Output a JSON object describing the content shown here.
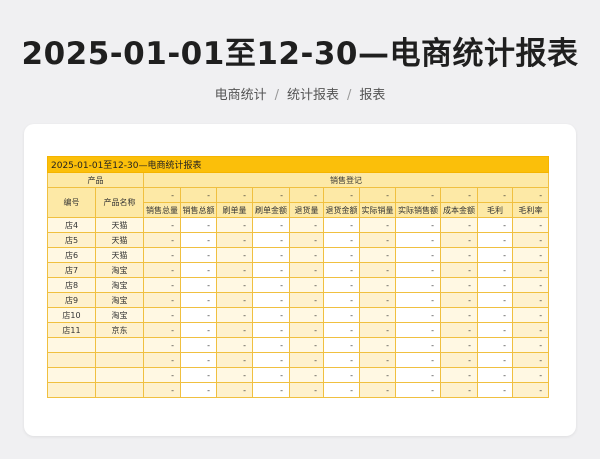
{
  "page": {
    "title": "2025-01-01至12-30—电商统计报表",
    "breadcrumb": [
      "电商统计",
      "统计报表",
      "报表"
    ]
  },
  "sheet": {
    "title": "2025-01-01至12-30—电商统计报表",
    "group_product": "产品",
    "group_sales": "销售登记",
    "col_id": "编号",
    "col_name": "产品名称",
    "columns": [
      "销售总量",
      "销售总额",
      "刷单量",
      "刷单金额",
      "退货量",
      "退货金额",
      "实际销量",
      "实际销售额",
      "成本金额",
      "毛利",
      "毛利率"
    ],
    "rows": [
      {
        "id": "店4",
        "name": "天猫"
      },
      {
        "id": "店5",
        "name": "天猫"
      },
      {
        "id": "店6",
        "name": "天猫"
      },
      {
        "id": "店7",
        "name": "淘宝"
      },
      {
        "id": "店8",
        "name": "淘宝"
      },
      {
        "id": "店9",
        "name": "淘宝"
      },
      {
        "id": "店10",
        "name": "淘宝"
      },
      {
        "id": "店11",
        "name": "京东"
      },
      {
        "id": "",
        "name": ""
      },
      {
        "id": "",
        "name": ""
      },
      {
        "id": "",
        "name": ""
      },
      {
        "id": "",
        "name": ""
      }
    ],
    "empty_value": "-"
  },
  "colors": {
    "accent": "#fbbf0a",
    "header": "#fde9a6",
    "row": "#fff8e3",
    "grid": "#f0c040"
  }
}
